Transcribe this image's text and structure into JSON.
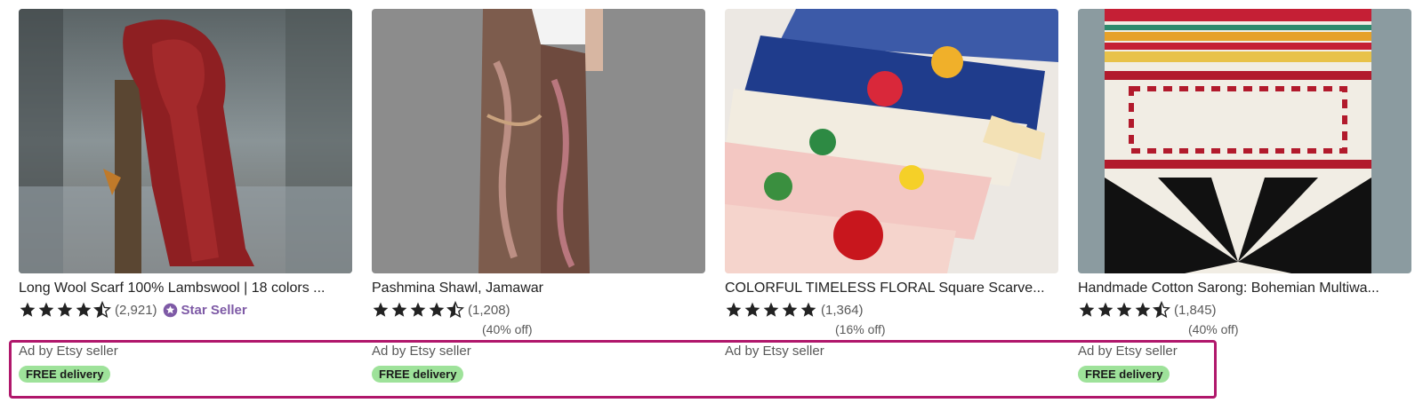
{
  "listings": [
    {
      "title": "Long Wool Scarf 100% Lambswool | 18 colors ...",
      "rating": 4.5,
      "review_count": "(2,921)",
      "star_seller_label": "Star Seller",
      "discount": "",
      "ad_label": "Ad by Etsy seller",
      "delivery_badge": "FREE delivery"
    },
    {
      "title": "Pashmina Shawl, Jamawar",
      "rating": 4.5,
      "review_count": "(1,208)",
      "star_seller_label": "",
      "discount": "(40% off)",
      "ad_label": "Ad by Etsy seller",
      "delivery_badge": "FREE delivery"
    },
    {
      "title": "COLORFUL TIMELESS FLORAL Square Scarve...",
      "rating": 5,
      "review_count": "(1,364)",
      "star_seller_label": "",
      "discount": "(16% off)",
      "ad_label": "Ad by Etsy seller",
      "delivery_badge": ""
    },
    {
      "title": "Handmade Cotton Sarong: Bohemian Multiwa...",
      "rating": 4.5,
      "review_count": "(1,845)",
      "star_seller_label": "",
      "discount": "(40% off)",
      "ad_label": "Ad by Etsy seller",
      "delivery_badge": "FREE delivery"
    }
  ],
  "colors": {
    "highlight_border": "#b0176b",
    "badge_bg": "#9ee29a",
    "star_seller": "#7e5aa6"
  },
  "icons": [
    "star-icon",
    "half-star-icon",
    "star-seller-badge-icon"
  ]
}
